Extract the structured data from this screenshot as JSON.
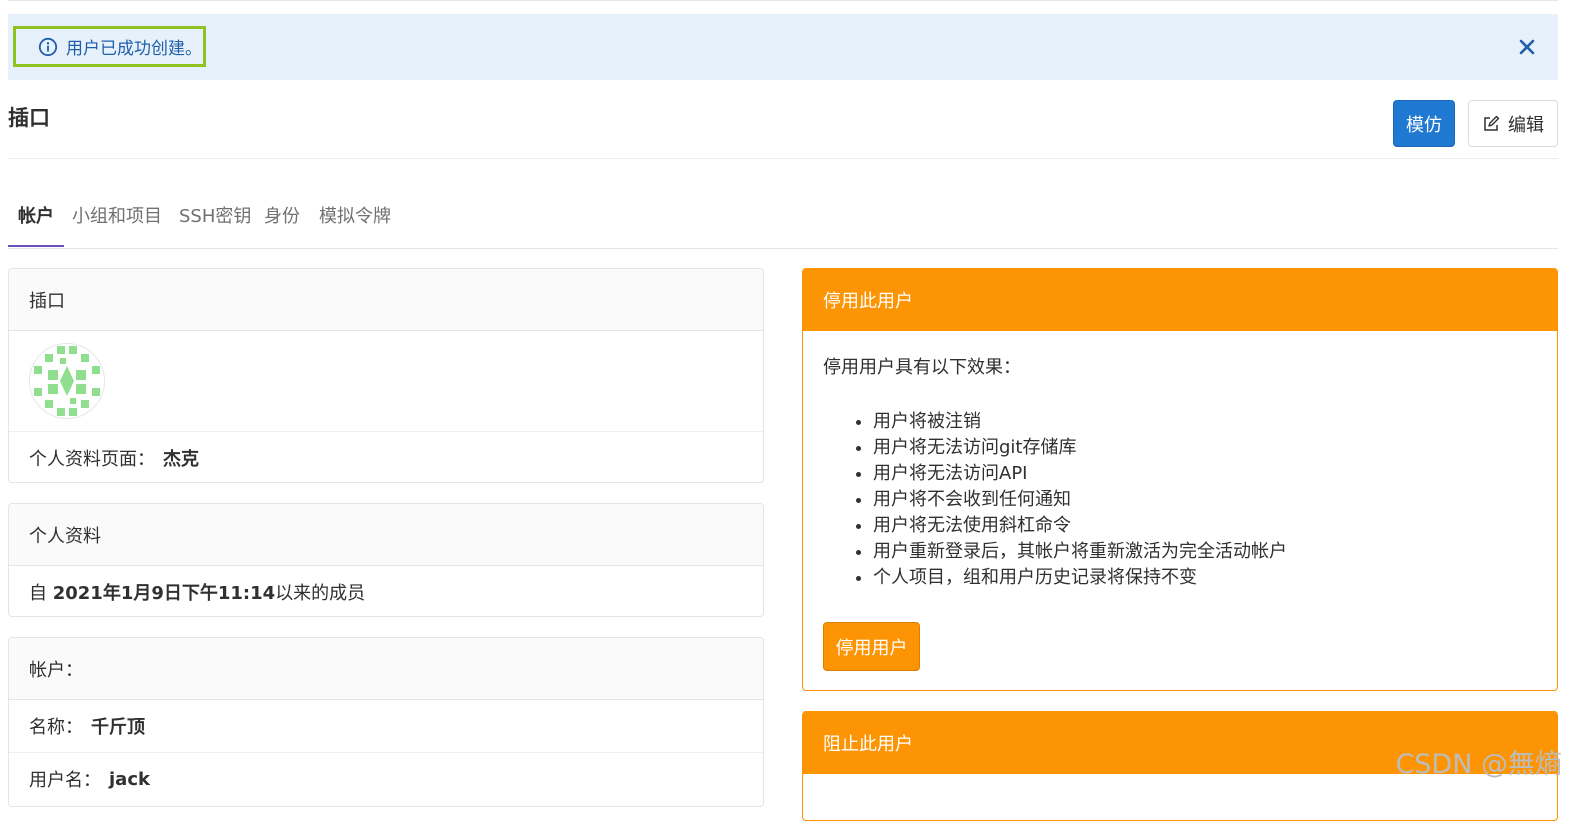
{
  "flash": {
    "message": "用户已成功创建。"
  },
  "header": {
    "title": "插口",
    "impersonate_label": "模仿",
    "edit_label": "编辑"
  },
  "tabs": [
    {
      "label": "帐户",
      "active": true
    },
    {
      "label": "小组和项目"
    },
    {
      "label": "SSH密钥"
    },
    {
      "label": "身份"
    },
    {
      "label": "模拟令牌"
    }
  ],
  "profile_card": {
    "title": "插口",
    "profile_page_label": "个人资料页面：",
    "profile_page_value": "杰克"
  },
  "personal_card": {
    "title": "个人资料",
    "member_prefix": "自 ",
    "member_date": "2021年1月9日下午11:14",
    "member_suffix": "以来的成员"
  },
  "account_card": {
    "title": "帐户：",
    "name_label": "名称：",
    "name_value": "千斤顶",
    "username_label": "用户名：",
    "username_value": "jack"
  },
  "deactivate_card": {
    "title": "停用此用户",
    "intro": "停用用户具有以下效果：",
    "effects": [
      "用户将被注销",
      "用户将无法访问git存储库",
      "用户将无法访问API",
      "用户将不会收到任何通知",
      "用户将无法使用斜杠命令",
      "用户重新登录后，其帐户将重新激活为完全活动帐户",
      "个人项目，组和用户历史记录将保持不变"
    ],
    "button_label": "停用用户"
  },
  "block_card": {
    "title": "阻止此用户"
  },
  "watermark": "CSDN @無熵",
  "colors": {
    "primary": "#1f78d1",
    "warning": "#fc9403",
    "flash_bg": "#e7f1fc",
    "highlight": "#8fc31f"
  }
}
